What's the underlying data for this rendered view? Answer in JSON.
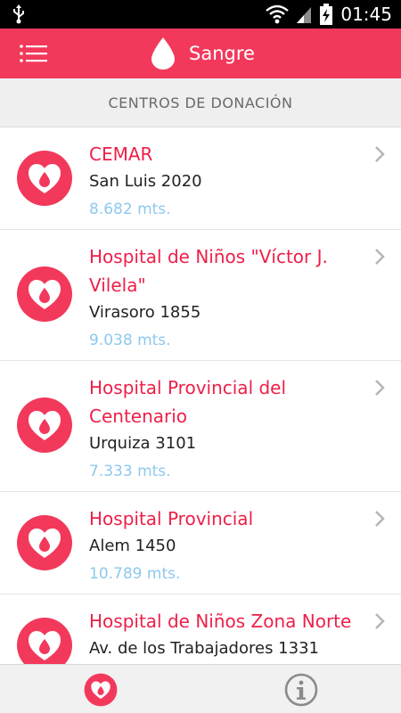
{
  "status_bar": {
    "time": "01:45"
  },
  "app_bar": {
    "title": "Sangre"
  },
  "section_header": "CENTROS DE DONACIÓN",
  "centers": [
    {
      "name": "CEMAR",
      "address": "San Luis 2020",
      "distance": "8.682 mts."
    },
    {
      "name": "Hospital de Niños \"Víctor J. Vilela\"",
      "address": "Virasoro 1855",
      "distance": "9.038 mts."
    },
    {
      "name": "Hospital Provincial del Centenario",
      "address": "Urquiza 3101",
      "distance": "7.333 mts."
    },
    {
      "name": "Hospital Provincial",
      "address": "Alem 1450",
      "distance": "10.789 mts."
    },
    {
      "name": "Hospital de Niños Zona Norte",
      "address": "Av. de los Trabajadores 1331",
      "distance": ""
    }
  ],
  "bottom_nav": {
    "tabs": [
      "donation-centers",
      "info"
    ]
  },
  "colors": {
    "accent": "#f2395c",
    "name_text": "#ee1f48",
    "distance_text": "#8ec8ee"
  }
}
